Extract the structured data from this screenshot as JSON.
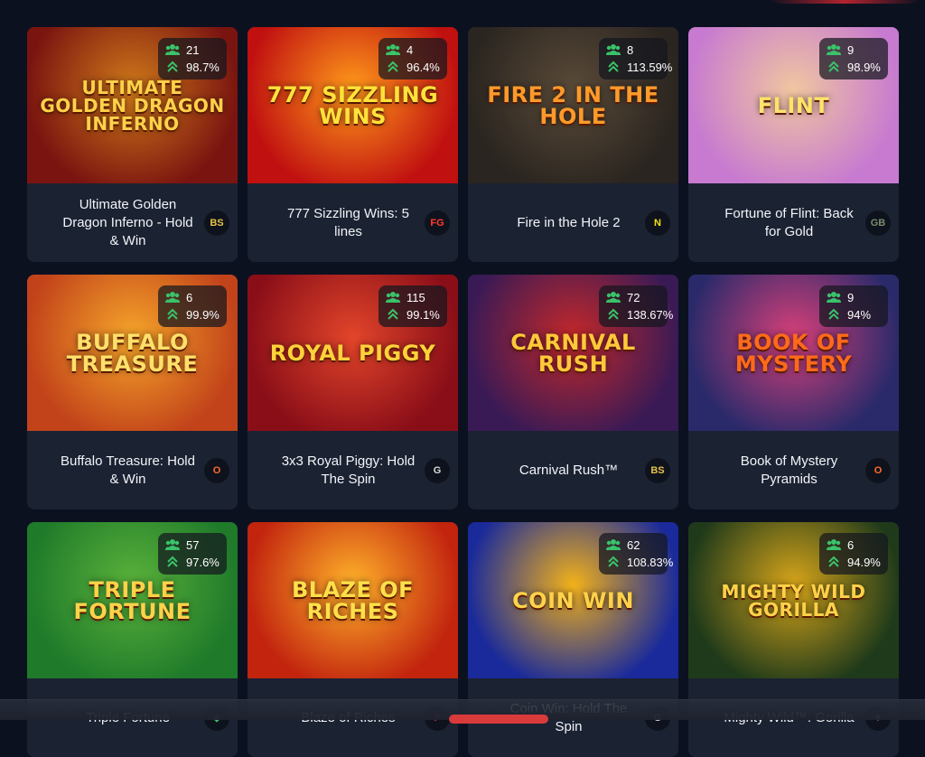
{
  "games": [
    {
      "title": "Ultimate Golden Dragon Inferno - Hold & Win",
      "players": "21",
      "rtp": "98.7%",
      "provider": "BS",
      "logo": "ULTIMATE GOLDEN DRAGON INFERNO",
      "bg": "#7a1410",
      "bg2": "#d07a1a",
      "logo_color": "#ffd24a",
      "prov_color": "#e5c24a"
    },
    {
      "title": "777 Sizzling Wins: 5 lines",
      "players": "4",
      "rtp": "96.4%",
      "provider": "FG",
      "logo": "777 SIZZLING WINS",
      "bg": "#c01010",
      "bg2": "#ff9a1a",
      "logo_color": "#ffe23a",
      "prov_color": "#ff3b2f"
    },
    {
      "title": "Fire in the Hole 2",
      "players": "8",
      "rtp": "113.59%",
      "provider": "N",
      "logo": "FIRE 2 IN THE HOLE",
      "bg": "#2a2520",
      "bg2": "#5a4a38",
      "logo_color": "#ff9a2a",
      "prov_color": "#f0e010"
    },
    {
      "title": "Fortune of Flint: Back for Gold",
      "players": "9",
      "rtp": "98.9%",
      "provider": "GB",
      "logo": "FLINT",
      "bg": "#c77ad0",
      "bg2": "#f0c6a0",
      "logo_color": "#ffe36a",
      "prov_color": "#7a8a70"
    },
    {
      "title": "Buffalo Treasure: Hold & Win",
      "players": "6",
      "rtp": "99.9%",
      "provider": "O",
      "logo": "BUFFALO TREASURE",
      "bg": "#c2431a",
      "bg2": "#f5a52a",
      "logo_color": "#ffe06a",
      "prov_color": "#ff6a2a"
    },
    {
      "title": "3x3 Royal Piggy: Hold The Spin",
      "players": "115",
      "rtp": "99.1%",
      "provider": "G",
      "logo": "ROYAL PIGGY",
      "bg": "#8a0e18",
      "bg2": "#e2452a",
      "logo_color": "#ffd23a",
      "prov_color": "#d9d9d9"
    },
    {
      "title": "Carnival Rush™",
      "players": "72",
      "rtp": "138.67%",
      "provider": "BS",
      "logo": "CARNIVAL RUSH",
      "bg": "#3a1a55",
      "bg2": "#c4282a",
      "logo_color": "#ffc83a",
      "prov_color": "#e5c24a"
    },
    {
      "title": "Book of Mystery Pyramids",
      "players": "9",
      "rtp": "94%",
      "provider": "O",
      "logo": "BOOK OF MYSTERY",
      "bg": "#2a2a6a",
      "bg2": "#d8407a",
      "logo_color": "#ff6a1a",
      "prov_color": "#ff6a2a"
    },
    {
      "title": "Triple Fortune",
      "players": "57",
      "rtp": "97.6%",
      "provider": "◆",
      "logo": "TRIPLE FORTUNE",
      "bg": "#1f7a2a",
      "bg2": "#5ab23a",
      "logo_color": "#ffd24a",
      "prov_color": "#3ac36a"
    },
    {
      "title": "Blaze of Riches",
      "players": "",
      "rtp": "",
      "provider": "P",
      "logo": "BLAZE OF RICHES",
      "bg": "#c2240e",
      "bg2": "#ffb22a",
      "logo_color": "#ffe04a",
      "prov_color": "#e8283a"
    },
    {
      "title": "Coin Win: Hold The Spin",
      "players": "62",
      "rtp": "108.83%",
      "provider": "G",
      "logo": "COIN WIN",
      "bg": "#1a2a9a",
      "bg2": "#f2b11a",
      "logo_color": "#ffd24a",
      "prov_color": "#d9d9d9"
    },
    {
      "title": "Mighty Wild™: Gorilla",
      "players": "6",
      "rtp": "94.9%",
      "provider": "▼",
      "logo": "MIGHTY WILD GORILLA",
      "bg": "#1f3a1a",
      "bg2": "#d7a51a",
      "logo_color": "#ffd24a",
      "prov_color": "#c0c0c0"
    }
  ],
  "icons": {
    "players": "players-icon",
    "rtp": "rtp-arrow-icon"
  },
  "colors": {
    "players_icon": "#3ac36a",
    "page_bg": "#0c1120",
    "card_bg": "#1b2232"
  }
}
